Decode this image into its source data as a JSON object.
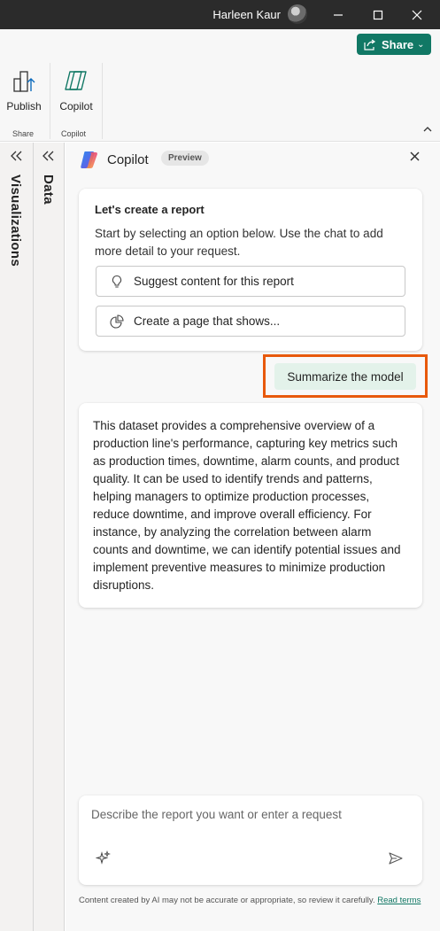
{
  "titlebar": {
    "user_name": "Harleen Kaur"
  },
  "ribbon": {
    "share_label": "Share",
    "buttons": [
      {
        "label": "Publish",
        "group": "Share"
      },
      {
        "label": "Copilot",
        "group": "Copilot"
      }
    ]
  },
  "panes": {
    "visualizations_label": "Visualizations",
    "data_label": "Data"
  },
  "copilot": {
    "title": "Copilot",
    "badge": "Preview",
    "welcome": {
      "heading": "Let's create a report",
      "body": "Start by selecting an option below. Use the chat to add more detail to your request.",
      "options": [
        {
          "label": "Suggest content for this report",
          "icon": "lightbulb-icon"
        },
        {
          "label": "Create a page that shows...",
          "icon": "pie-chart-icon"
        }
      ]
    },
    "user_prompt": "Summarize the model",
    "answer": "This dataset provides a comprehensive overview of a production line's performance, capturing key metrics such as production times, downtime, alarm counts, and product quality. It can be used to identify trends and patterns, helping managers to optimize production processes, reduce downtime, and improve overall efficiency. For instance, by analyzing the correlation between alarm counts and downtime, we can identify potential issues and implement preventive measures to minimize production disruptions.",
    "input_placeholder": "Describe the report you want or enter a request",
    "disclaimer": "Content created by AI may not be accurate or appropriate, so review it carefully.",
    "disclaimer_link": "Read terms"
  },
  "colors": {
    "accent": "#117865",
    "highlight": "#e8590c",
    "prompt_bg": "#e3f2ea",
    "titlebar": "#2b2b2b"
  }
}
